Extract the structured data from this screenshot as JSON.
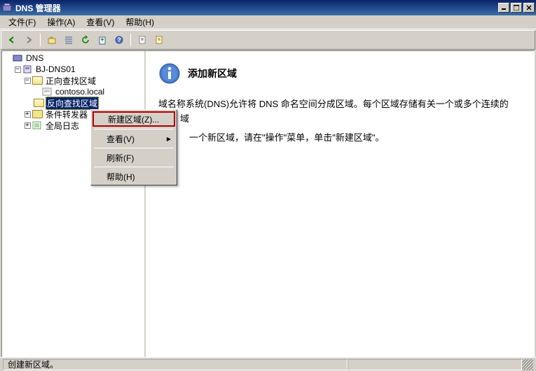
{
  "window": {
    "title": "DNS 管理器"
  },
  "menu": {
    "file": "文件(F)",
    "action": "操作(A)",
    "view": "查看(V)",
    "help": "帮助(H)"
  },
  "tree": {
    "root": "DNS",
    "server": "BJ-DNS01",
    "fwd": "正向查找区域",
    "fwd_zone": "contoso.local",
    "rev": "反向查找区域",
    "cond": "条件转发器",
    "log": "全局日志"
  },
  "content": {
    "title": "添加新区域",
    "p1": "域名称系统(DNS)允许将 DNS 命名空间分成区域。每个区域存储有关一个或多个连续的 DNS 域",
    "p2": "一个新区域，请在\"操作\"菜单，单击\"新建区域\"。"
  },
  "ctx": {
    "new_zone": "新建区域(Z)...",
    "view": "查看(V)",
    "refresh": "刷新(F)",
    "help": "帮助(H)"
  },
  "status": {
    "text": "创建新区域。"
  }
}
